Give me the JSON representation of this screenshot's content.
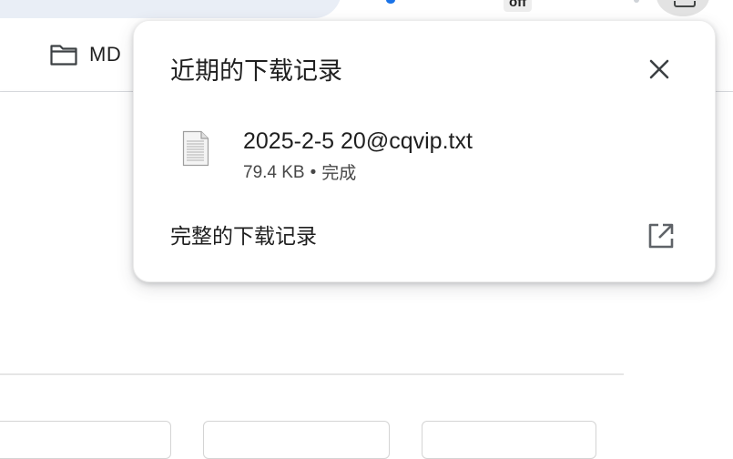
{
  "browser": {
    "top_badge_text": "off",
    "bookmark_bar": {
      "items": [
        {
          "label": "MD",
          "icon": "folder-icon"
        }
      ]
    }
  },
  "downloads_bubble": {
    "title": "近期的下载记录",
    "close_icon": "close-icon",
    "items": [
      {
        "file_name": "2025-2-5 20@cqvip.txt",
        "size": "79.4 KB",
        "separator": "•",
        "status": "完成",
        "icon": "text-file-icon"
      }
    ],
    "full_history_label": "完整的下载记录",
    "full_history_icon": "open-in-new-icon"
  },
  "colors": {
    "text_primary": "#1f1f1f",
    "text_secondary": "#474747",
    "icon_grey": "#5f6368",
    "omnibox_bg": "#e9eef6",
    "accent_blue": "#1a73e8"
  }
}
